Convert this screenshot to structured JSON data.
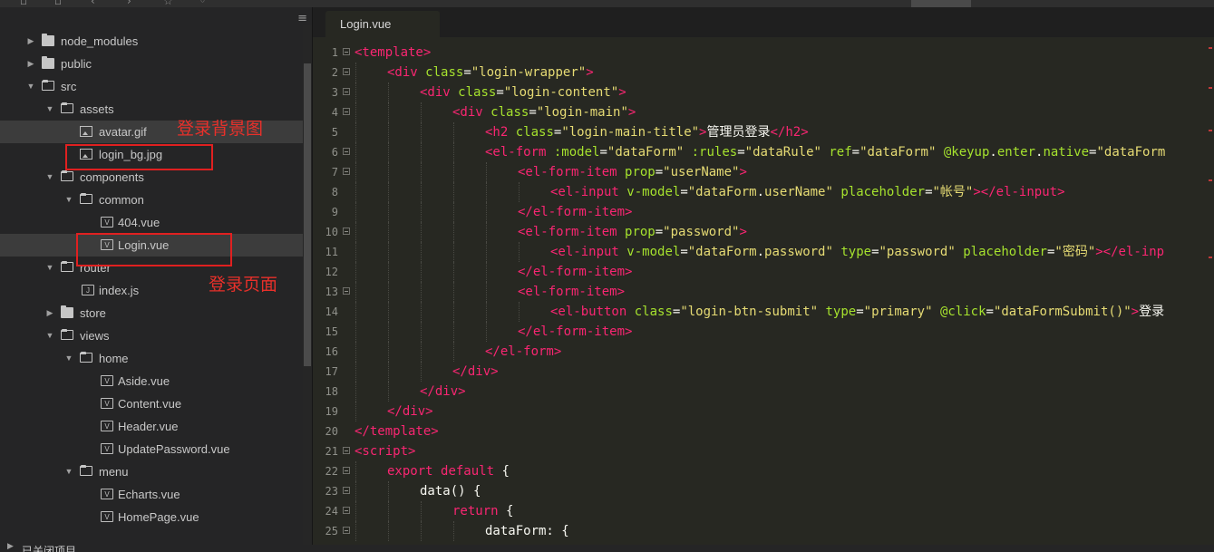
{
  "sidebar": {
    "tree": [
      {
        "label": "node_modules",
        "type": "folder",
        "expanded": false,
        "depth": 0
      },
      {
        "label": "public",
        "type": "folder",
        "expanded": false,
        "depth": 0
      },
      {
        "label": "src",
        "type": "folder",
        "expanded": true,
        "depth": 0
      },
      {
        "label": "assets",
        "type": "folder",
        "expanded": true,
        "depth": 1
      },
      {
        "label": "avatar.gif",
        "type": "image",
        "depth": 2,
        "selected": true
      },
      {
        "label": "login_bg.jpg",
        "type": "image",
        "depth": 2
      },
      {
        "label": "components",
        "type": "folder",
        "expanded": true,
        "depth": 1
      },
      {
        "label": "common",
        "type": "folder",
        "expanded": true,
        "depth": 2
      },
      {
        "label": "404.vue",
        "type": "vue",
        "depth": 3
      },
      {
        "label": "Login.vue",
        "type": "vue",
        "depth": 3,
        "selected": true
      },
      {
        "label": "router",
        "type": "folder",
        "expanded": true,
        "depth": 1
      },
      {
        "label": "index.js",
        "type": "js",
        "depth": 2
      },
      {
        "label": "store",
        "type": "folder",
        "expanded": false,
        "depth": 1
      },
      {
        "label": "views",
        "type": "folder",
        "expanded": true,
        "depth": 1
      },
      {
        "label": "home",
        "type": "folder",
        "expanded": true,
        "depth": 2
      },
      {
        "label": "Aside.vue",
        "type": "vue",
        "depth": 3
      },
      {
        "label": "Content.vue",
        "type": "vue",
        "depth": 3
      },
      {
        "label": "Header.vue",
        "type": "vue",
        "depth": 3
      },
      {
        "label": "UpdatePassword.vue",
        "type": "vue",
        "depth": 3
      },
      {
        "label": "menu",
        "type": "folder",
        "expanded": true,
        "depth": 2
      },
      {
        "label": "Echarts.vue",
        "type": "vue",
        "depth": 3
      },
      {
        "label": "HomePage.vue",
        "type": "vue",
        "depth": 3
      }
    ],
    "bottom_label": "已关闭项目",
    "annotations": {
      "bg_note": "登录背景图",
      "page_note": "登录页面"
    }
  },
  "editor": {
    "tab_label": "Login.vue",
    "lines": [
      {
        "n": "1",
        "fold": true,
        "indent": 0,
        "tokens": [
          [
            "tag",
            "<template"
          ],
          [
            "tag",
            ">"
          ]
        ]
      },
      {
        "n": "2",
        "fold": true,
        "indent": 1,
        "tokens": [
          [
            "tag",
            "<div"
          ],
          [
            "plain",
            " "
          ],
          [
            "attr",
            "class"
          ],
          [
            "plain",
            "="
          ],
          [
            "str",
            "\"login-wrapper\""
          ],
          [
            "tag",
            ">"
          ]
        ]
      },
      {
        "n": "3",
        "fold": true,
        "indent": 2,
        "tokens": [
          [
            "tag",
            "<div"
          ],
          [
            "plain",
            " "
          ],
          [
            "attr",
            "class"
          ],
          [
            "plain",
            "="
          ],
          [
            "str",
            "\"login-content\""
          ],
          [
            "tag",
            ">"
          ]
        ]
      },
      {
        "n": "4",
        "fold": true,
        "indent": 3,
        "tokens": [
          [
            "tag",
            "<div"
          ],
          [
            "plain",
            " "
          ],
          [
            "attr",
            "class"
          ],
          [
            "plain",
            "="
          ],
          [
            "str",
            "\"login-main\""
          ],
          [
            "tag",
            ">"
          ]
        ]
      },
      {
        "n": "5",
        "fold": false,
        "indent": 4,
        "tokens": [
          [
            "tag",
            "<h2"
          ],
          [
            "plain",
            " "
          ],
          [
            "attr",
            "class"
          ],
          [
            "plain",
            "="
          ],
          [
            "str",
            "\"login-main-title\""
          ],
          [
            "tag",
            ">"
          ],
          [
            "plain",
            "管理员登录"
          ],
          [
            "tag",
            "</h2>"
          ]
        ]
      },
      {
        "n": "6",
        "fold": true,
        "indent": 4,
        "tokens": [
          [
            "tag",
            "<el-form"
          ],
          [
            "plain",
            " "
          ],
          [
            "attr",
            ":model"
          ],
          [
            "plain",
            "="
          ],
          [
            "str",
            "\"dataForm\""
          ],
          [
            "plain",
            " "
          ],
          [
            "attr",
            ":rules"
          ],
          [
            "plain",
            "="
          ],
          [
            "str",
            "\"dataRule\""
          ],
          [
            "plain",
            " "
          ],
          [
            "attr",
            "ref"
          ],
          [
            "plain",
            "="
          ],
          [
            "str",
            "\"dataForm\""
          ],
          [
            "plain",
            " "
          ],
          [
            "attr",
            "@keyup"
          ],
          [
            "plain",
            "."
          ],
          [
            "attr",
            "enter"
          ],
          [
            "plain",
            "."
          ],
          [
            "attr",
            "native"
          ],
          [
            "plain",
            "="
          ],
          [
            "str",
            "\"dataForm"
          ]
        ]
      },
      {
        "n": "7",
        "fold": true,
        "indent": 5,
        "tokens": [
          [
            "tag",
            "<el-form-item"
          ],
          [
            "plain",
            " "
          ],
          [
            "attr",
            "prop"
          ],
          [
            "plain",
            "="
          ],
          [
            "str",
            "\"userName\""
          ],
          [
            "tag",
            ">"
          ]
        ]
      },
      {
        "n": "8",
        "fold": false,
        "indent": 6,
        "tokens": [
          [
            "tag",
            "<el-input"
          ],
          [
            "plain",
            " "
          ],
          [
            "attr",
            "v-model"
          ],
          [
            "plain",
            "="
          ],
          [
            "str",
            "\"dataForm"
          ],
          [
            "plain",
            "."
          ],
          [
            "str",
            "userName\""
          ],
          [
            "plain",
            " "
          ],
          [
            "attr",
            "placeholder"
          ],
          [
            "plain",
            "="
          ],
          [
            "str",
            "\"帐号\""
          ],
          [
            "tag",
            "></el-input>"
          ]
        ]
      },
      {
        "n": "9",
        "fold": false,
        "indent": 5,
        "tokens": [
          [
            "tag",
            "</el-form-item>"
          ]
        ]
      },
      {
        "n": "10",
        "fold": true,
        "indent": 5,
        "tokens": [
          [
            "tag",
            "<el-form-item"
          ],
          [
            "plain",
            " "
          ],
          [
            "attr",
            "prop"
          ],
          [
            "plain",
            "="
          ],
          [
            "str",
            "\"password\""
          ],
          [
            "tag",
            ">"
          ]
        ]
      },
      {
        "n": "11",
        "fold": false,
        "indent": 6,
        "tokens": [
          [
            "tag",
            "<el-input"
          ],
          [
            "plain",
            " "
          ],
          [
            "attr",
            "v-model"
          ],
          [
            "plain",
            "="
          ],
          [
            "str",
            "\"dataForm"
          ],
          [
            "plain",
            "."
          ],
          [
            "str",
            "password\""
          ],
          [
            "plain",
            " "
          ],
          [
            "attr",
            "type"
          ],
          [
            "plain",
            "="
          ],
          [
            "str",
            "\"password\""
          ],
          [
            "plain",
            " "
          ],
          [
            "attr",
            "placeholder"
          ],
          [
            "plain",
            "="
          ],
          [
            "str",
            "\"密码\""
          ],
          [
            "tag",
            "></el-inp"
          ]
        ]
      },
      {
        "n": "12",
        "fold": false,
        "indent": 5,
        "tokens": [
          [
            "tag",
            "</el-form-item>"
          ]
        ]
      },
      {
        "n": "13",
        "fold": true,
        "indent": 5,
        "tokens": [
          [
            "tag",
            "<el-form-item"
          ],
          [
            "tag",
            ">"
          ]
        ]
      },
      {
        "n": "14",
        "fold": false,
        "indent": 6,
        "tokens": [
          [
            "tag",
            "<el-button"
          ],
          [
            "plain",
            " "
          ],
          [
            "attr",
            "class"
          ],
          [
            "plain",
            "="
          ],
          [
            "str",
            "\"login-btn-submit\""
          ],
          [
            "plain",
            " "
          ],
          [
            "attr",
            "type"
          ],
          [
            "plain",
            "="
          ],
          [
            "str",
            "\"primary\""
          ],
          [
            "plain",
            " "
          ],
          [
            "attr",
            "@click"
          ],
          [
            "plain",
            "="
          ],
          [
            "str",
            "\"dataFormSubmit()\""
          ],
          [
            "tag",
            ">"
          ],
          [
            "plain",
            "登录"
          ]
        ]
      },
      {
        "n": "15",
        "fold": false,
        "indent": 5,
        "tokens": [
          [
            "tag",
            "</el-form-item>"
          ]
        ]
      },
      {
        "n": "16",
        "fold": false,
        "indent": 4,
        "tokens": [
          [
            "tag",
            "</el-form>"
          ]
        ]
      },
      {
        "n": "17",
        "fold": false,
        "indent": 3,
        "tokens": [
          [
            "tag",
            "</div>"
          ]
        ]
      },
      {
        "n": "18",
        "fold": false,
        "indent": 2,
        "tokens": [
          [
            "tag",
            "</div>"
          ]
        ]
      },
      {
        "n": "19",
        "fold": false,
        "indent": 1,
        "tokens": [
          [
            "tag",
            "</div>"
          ]
        ]
      },
      {
        "n": "20",
        "fold": false,
        "indent": 0,
        "tokens": [
          [
            "tag",
            "</template>"
          ]
        ]
      },
      {
        "n": "21",
        "fold": true,
        "indent": 0,
        "tokens": [
          [
            "tag",
            "<script"
          ],
          [
            "tag",
            ">"
          ]
        ]
      },
      {
        "n": "22",
        "fold": true,
        "indent": 1,
        "tokens": [
          [
            "kw",
            "export"
          ],
          [
            "plain",
            " "
          ],
          [
            "kw",
            "default"
          ],
          [
            "plain",
            " {"
          ]
        ]
      },
      {
        "n": "23",
        "fold": true,
        "indent": 2,
        "tokens": [
          [
            "plain",
            "data() {"
          ]
        ]
      },
      {
        "n": "24",
        "fold": true,
        "indent": 3,
        "tokens": [
          [
            "kw",
            "return"
          ],
          [
            "plain",
            " {"
          ]
        ]
      },
      {
        "n": "25",
        "fold": true,
        "indent": 4,
        "tokens": [
          [
            "plain",
            "dataForm: {"
          ]
        ]
      }
    ]
  },
  "colors": {
    "tag": "#f92672",
    "attr": "#a6e22e",
    "string": "#e6db74",
    "text": "#f8f8f2",
    "annotation": "#e02020"
  }
}
